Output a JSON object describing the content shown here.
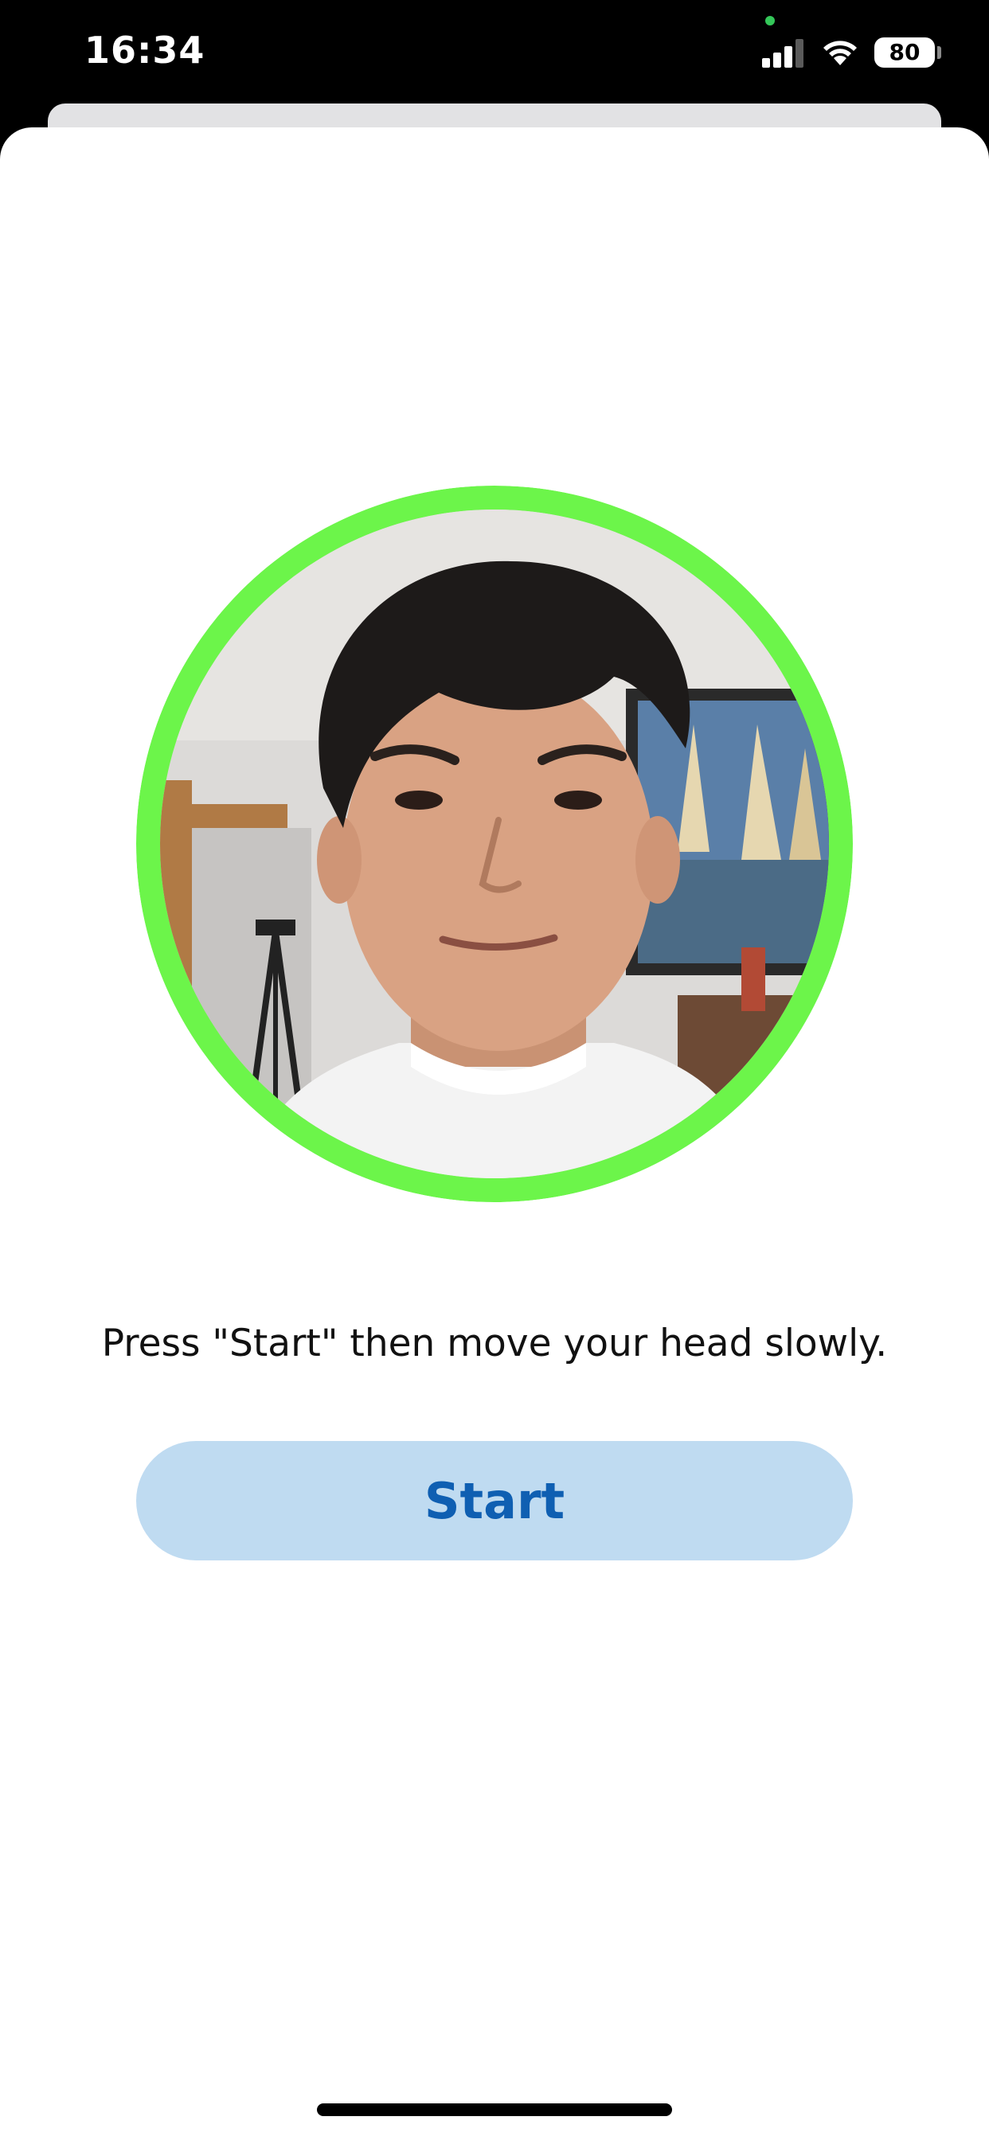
{
  "status_bar": {
    "time": "16:34",
    "battery_level": "80",
    "signal_icon": "cellular-signal-icon",
    "wifi_icon": "wifi-icon"
  },
  "colors": {
    "ring": "#6cf54a",
    "privacy_dot": "#34c759",
    "button_bg": "#bfdbf1",
    "button_text": "#0f5fb2"
  },
  "camera_preview": {
    "content": "front-camera live preview showing user's face"
  },
  "instruction_text": "Press \"Start\" then move your head slowly.",
  "start_button_label": "Start"
}
